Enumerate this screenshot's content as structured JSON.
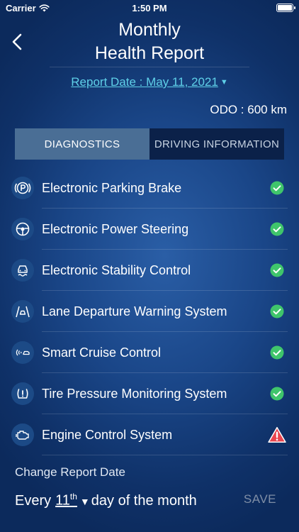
{
  "status_bar": {
    "carrier": "Carrier",
    "time": "1:50 PM"
  },
  "header": {
    "title_line1": "Monthly",
    "title_line2": "Health Report",
    "report_date": "Report Date : May 11, 2021",
    "odo": "ODO : 600 km"
  },
  "tabs": [
    {
      "label": "DIAGNOSTICS",
      "active": true
    },
    {
      "label": "DRIVING INFORMATION",
      "active": false
    }
  ],
  "systems": [
    {
      "label": "Electronic Parking Brake",
      "icon": "parking-brake-icon",
      "status": "ok"
    },
    {
      "label": "Electronic Power Steering",
      "icon": "steering-wheel-icon",
      "status": "ok"
    },
    {
      "label": "Electronic Stability Control",
      "icon": "stability-control-icon",
      "status": "ok"
    },
    {
      "label": "Lane Departure Warning System",
      "icon": "lane-departure-icon",
      "status": "ok"
    },
    {
      "label": "Smart Cruise Control",
      "icon": "cruise-control-icon",
      "status": "ok"
    },
    {
      "label": "Tire Pressure Monitoring System",
      "icon": "tire-pressure-icon",
      "status": "ok"
    },
    {
      "label": "Engine Control System",
      "icon": "engine-icon",
      "status": "warning"
    }
  ],
  "footer": {
    "change_label": "Change Report Date",
    "every_prefix": "Every",
    "day_number": "11",
    "day_suffix": "th",
    "every_suffix": "day of the month",
    "save_label": "SAVE"
  },
  "colors": {
    "accent": "#5fd0e8",
    "ok": "#3fc56b",
    "warning": "#e8454f",
    "tab_active": "#4a6e95",
    "tab_inactive": "#0b2149"
  }
}
